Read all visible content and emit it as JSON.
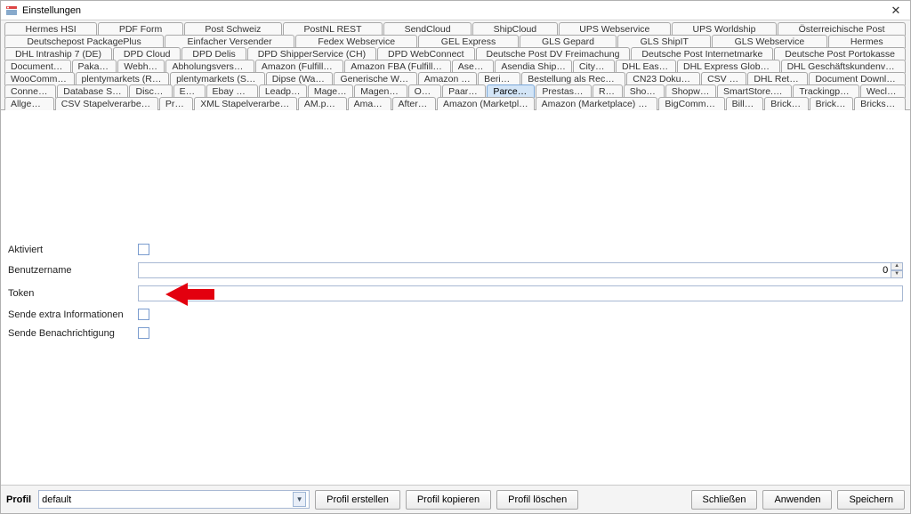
{
  "window": {
    "title": "Einstellungen"
  },
  "tabs": {
    "rows": [
      [
        "Hermes HSI",
        "PDF Form",
        "Post Schweiz",
        "PostNL REST",
        "SendCloud",
        "ShipCloud",
        "UPS Webservice",
        "UPS Worldship",
        "Österreichische Post"
      ],
      [
        "Deutschepost PackagePlus",
        "Einfacher Versender",
        "Fedex Webservice",
        "GEL Express",
        "GLS Gepard",
        "GLS ShipIT",
        "GLS Webservice",
        "Hermes"
      ],
      [
        "DHL Intraship 7 (DE)",
        "DPD Cloud",
        "DPD Delis",
        "DPD ShipperService (CH)",
        "DPD WebConnect",
        "Deutsche Post DV Freimachung",
        "Deutsche Post Internetmarke",
        "Deutsche Post Portokasse"
      ],
      [
        "Document Log",
        "Pakadoo",
        "Webhook",
        "Abholungsversender",
        "Amazon (Fulfillment)",
        "Amazon FBA (Fulfillment)",
        "Asendia",
        "Asendia Shipping",
        "Citymail",
        "DHL Easylog",
        "DHL Express Global WS",
        "DHL Geschäftskundenversand"
      ],
      [
        "WooCommerce",
        "plentymarkets (REST)",
        "plentymarkets (SOAP)",
        "Dipse (Waage)",
        "Generische Waage",
        "Amazon Log",
        "Berichte",
        "Bestellung als Rechnung",
        "CN23 Dokument",
        "CSV Log",
        "DHL Retoure",
        "Document Downloader"
      ],
      [
        "Connector",
        "Database Shop",
        "Discogs",
        "Ebay",
        "Ebay XML",
        "Leadprint",
        "Magento",
        "Magento 2",
        "Odoo",
        "Paarzeit",
        "Parcellab",
        "Prestashop",
        "Real",
        "Shopify",
        "Shopware",
        "SmartStore.NET",
        "Trackingportal",
        "Weclapp"
      ],
      [
        "Allgemein",
        "CSV Stapelverarbeitung",
        "Proxy",
        "XML Stapelverarbeitung",
        "AM.portal",
        "Amazon",
        "Afterbuy",
        "Amazon (Marketplace)",
        "Amazon (Marketplace) REST",
        "BigCommerce",
        "Billbee",
        "Bricklink",
        "Brickowl",
        "Brickscout"
      ]
    ],
    "selected": "Parcellab"
  },
  "form": {
    "aktiviert": {
      "label": "Aktiviert",
      "checked": false
    },
    "benutzername": {
      "label": "Benutzername",
      "value": "0"
    },
    "token": {
      "label": "Token",
      "value": ""
    },
    "sende_extra": {
      "label": "Sende extra Informationen",
      "checked": false
    },
    "sende_benachrichtigung": {
      "label": "Sende Benachrichtigung",
      "checked": false
    }
  },
  "bottom": {
    "profil_label": "Profil",
    "profil_value": "default",
    "btn_profil_erstellen": "Profil erstellen",
    "btn_profil_kopieren": "Profil kopieren",
    "btn_profil_loeschen": "Profil löschen",
    "btn_schliessen": "Schließen",
    "btn_anwenden": "Anwenden",
    "btn_speichern": "Speichern"
  }
}
